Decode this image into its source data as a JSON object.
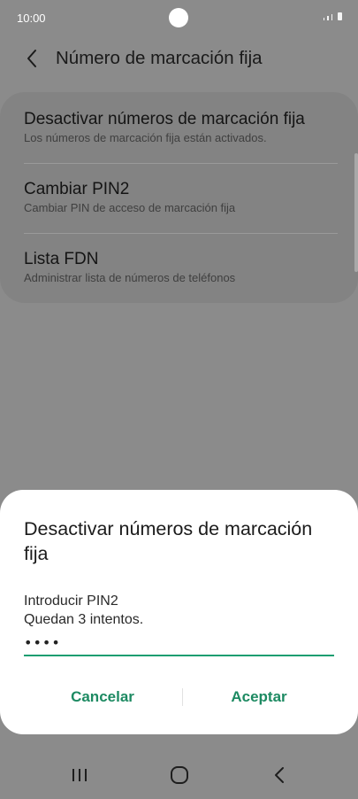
{
  "status_bar": {
    "time": "10:00"
  },
  "header": {
    "title": "Número de marcación fija"
  },
  "settings": [
    {
      "title": "Desactivar números de marcación fija",
      "subtitle": "Los números de marcación fija están activados."
    },
    {
      "title": "Cambiar PIN2",
      "subtitle": "Cambiar PIN de acceso de marcación fija"
    },
    {
      "title": "Lista FDN",
      "subtitle": "Administrar lista de números de teléfonos"
    }
  ],
  "dialog": {
    "title": "Desactivar números de marcación fija",
    "pin_label": "Introducir PIN2",
    "attempts": "Quedan 3 intentos.",
    "pin_value": "••••",
    "cancel_label": "Cancelar",
    "accept_label": "Aceptar"
  },
  "colors": {
    "accent": "#1d9e71",
    "button_text": "#1d8a62",
    "dim_background": "#8b8b8b"
  },
  "icons": {
    "back": "chevron-left-icon",
    "nav_recents": "recents-icon",
    "nav_home": "home-icon",
    "nav_back": "back-icon"
  }
}
